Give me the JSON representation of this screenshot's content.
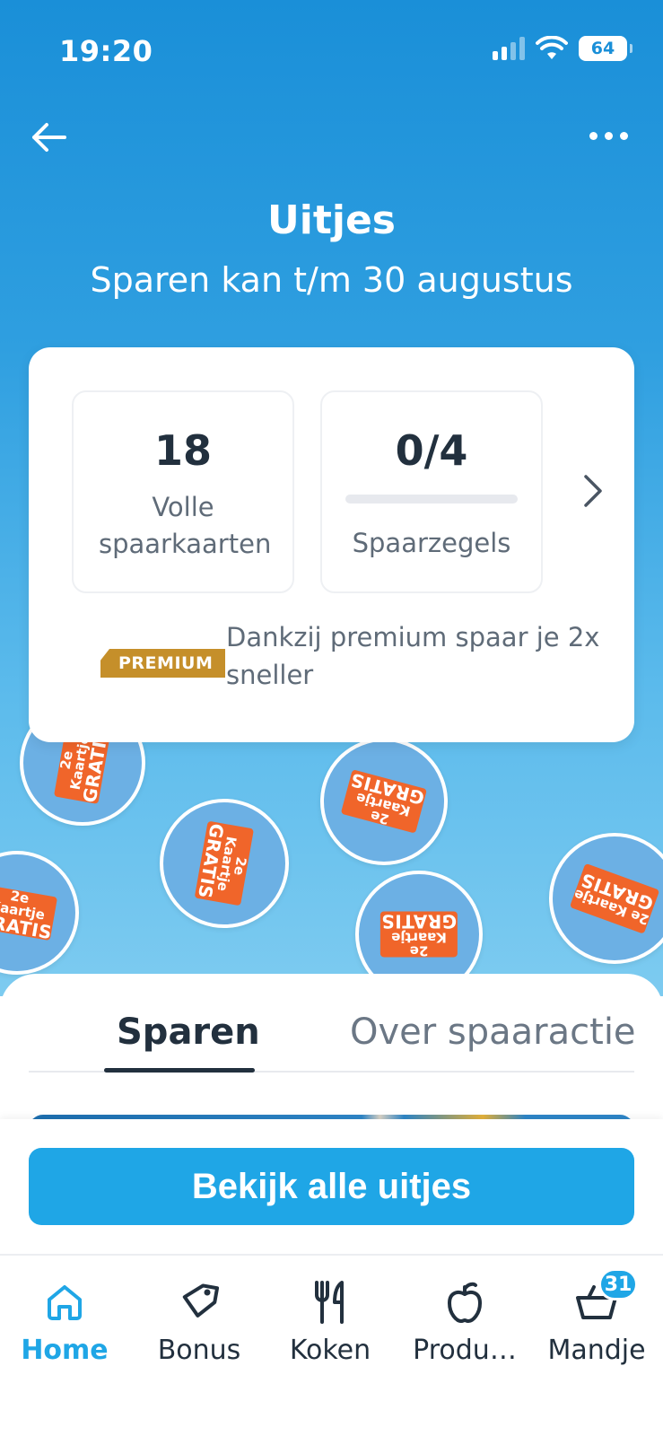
{
  "status_bar": {
    "time": "19:20",
    "battery": "64"
  },
  "header": {
    "title": "Uitjes",
    "subtitle": "Sparen kan t/m 30 augustus"
  },
  "card": {
    "full_cards": {
      "value": "18",
      "label": "Volle spaarkaarten"
    },
    "stamps": {
      "value": "0/4",
      "label": "Spaarzegels",
      "progress": 0
    },
    "premium": {
      "badge": "PREMIUM",
      "text": "Dankzij premium spaar je 2x sneller"
    }
  },
  "stamp_art": {
    "line1": "2e Kaartje",
    "line2": "GRATIS",
    "ring": "Uitjes-zegel"
  },
  "tabs": [
    {
      "label": "Sparen",
      "active": true
    },
    {
      "label": "Over spaaractie",
      "active": false
    }
  ],
  "cta": {
    "label": "Bekijk alle uitjes"
  },
  "bottom_nav": [
    {
      "label": "Home",
      "icon": "home-icon",
      "active": true
    },
    {
      "label": "Bonus",
      "icon": "tag-icon"
    },
    {
      "label": "Koken",
      "icon": "cutlery-icon"
    },
    {
      "label": "Produ…",
      "icon": "apple-icon"
    },
    {
      "label": "Mandje",
      "icon": "basket-icon",
      "badge": "31"
    }
  ],
  "colors": {
    "accent": "#1fa6e6",
    "hero": "#2f9fe0",
    "premium": "#c58f2a",
    "ticket": "#f0652a"
  }
}
